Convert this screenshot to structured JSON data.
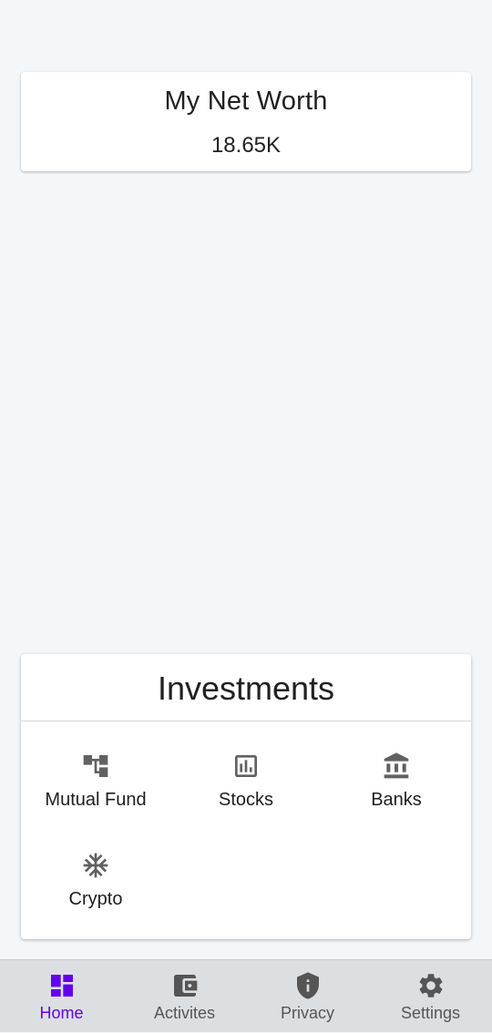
{
  "networth": {
    "title": "My Net Worth",
    "value": "18.65K"
  },
  "investments": {
    "title": "Investments",
    "items": [
      {
        "label": "Mutual Fund",
        "icon": "account-tree-icon"
      },
      {
        "label": "Stocks",
        "icon": "bar-chart-icon"
      },
      {
        "label": "Banks",
        "icon": "bank-icon"
      },
      {
        "label": "Crypto",
        "icon": "snowflake-icon"
      }
    ]
  },
  "bottom_nav": {
    "active": "Home",
    "items": [
      {
        "label": "Home",
        "icon": "dashboard-icon"
      },
      {
        "label": "Activites",
        "icon": "wallet-icon"
      },
      {
        "label": "Privacy",
        "icon": "shield-icon"
      },
      {
        "label": "Settings",
        "icon": "gear-icon"
      }
    ]
  },
  "colors": {
    "background": "#f4f7f9",
    "accent": "#6200ee",
    "icon_gray": "#616161",
    "nav_background": "#dcdfe2"
  }
}
